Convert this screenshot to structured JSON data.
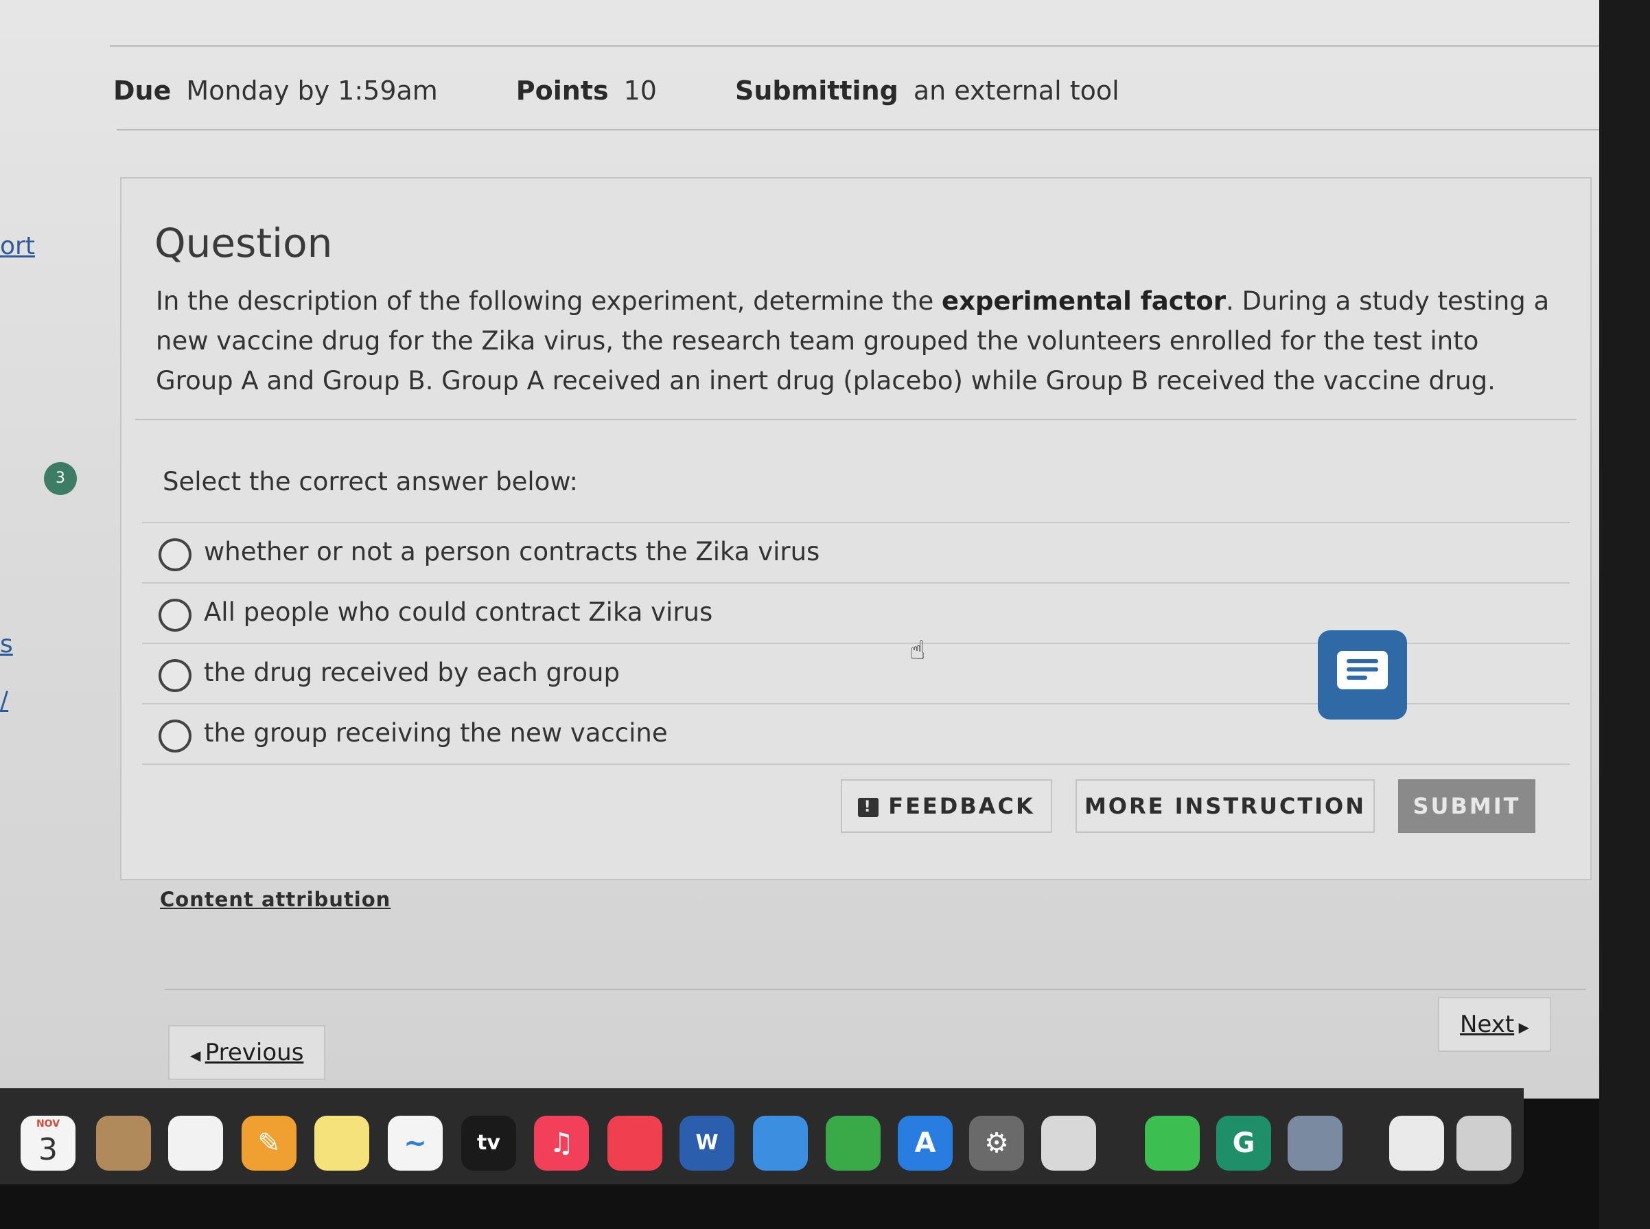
{
  "meta": {
    "due_label": "Due",
    "due_value": "Monday by 1:59am",
    "points_label": "Points",
    "points_value": "10",
    "submitting_label": "Submitting",
    "submitting_value": "an external tool"
  },
  "sidebar": {
    "link_partial_1": "ort",
    "link_partial_2": "s",
    "link_partial_3": "/",
    "badge_count": "3"
  },
  "question": {
    "title": "Question",
    "text_before": "In the description of the following experiment, determine the ",
    "text_bold": "experimental factor",
    "text_after": ". During a study testing a new vaccine drug for the Zika virus, the research team grouped the volunteers enrolled for the test into Group A and Group B. Group A received an inert drug (placebo) while Group B received the vaccine drug.",
    "select_label": "Select the correct answer below:",
    "options": [
      "whether or not a person contracts the Zika virus",
      "All people who could contract Zika virus",
      "the drug received by each group",
      "the group receiving the new vaccine"
    ]
  },
  "buttons": {
    "feedback": "FEEDBACK",
    "more_instruction": "MORE INSTRUCTION",
    "submit": "SUBMIT"
  },
  "footer": {
    "content_attribution": "Content attribution",
    "previous": "Previous",
    "next": "Next"
  },
  "dock": {
    "calendar_month": "NOV",
    "calendar_day": "3",
    "tv_label": "tv",
    "icons": [
      "finder-contacts-icon",
      "reminders-icon",
      "pages-icon",
      "notes-icon",
      "freeform-icon",
      "apple-tv-icon",
      "music-icon",
      "news-icon",
      "word-icon",
      "keynote-icon",
      "numbers-icon",
      "app-store-icon",
      "system-settings-icon",
      "iphone-mirroring-icon",
      "whatsapp-icon",
      "grammarly-icon",
      "preview-icon",
      "documents-icon",
      "trash-icon"
    ]
  }
}
